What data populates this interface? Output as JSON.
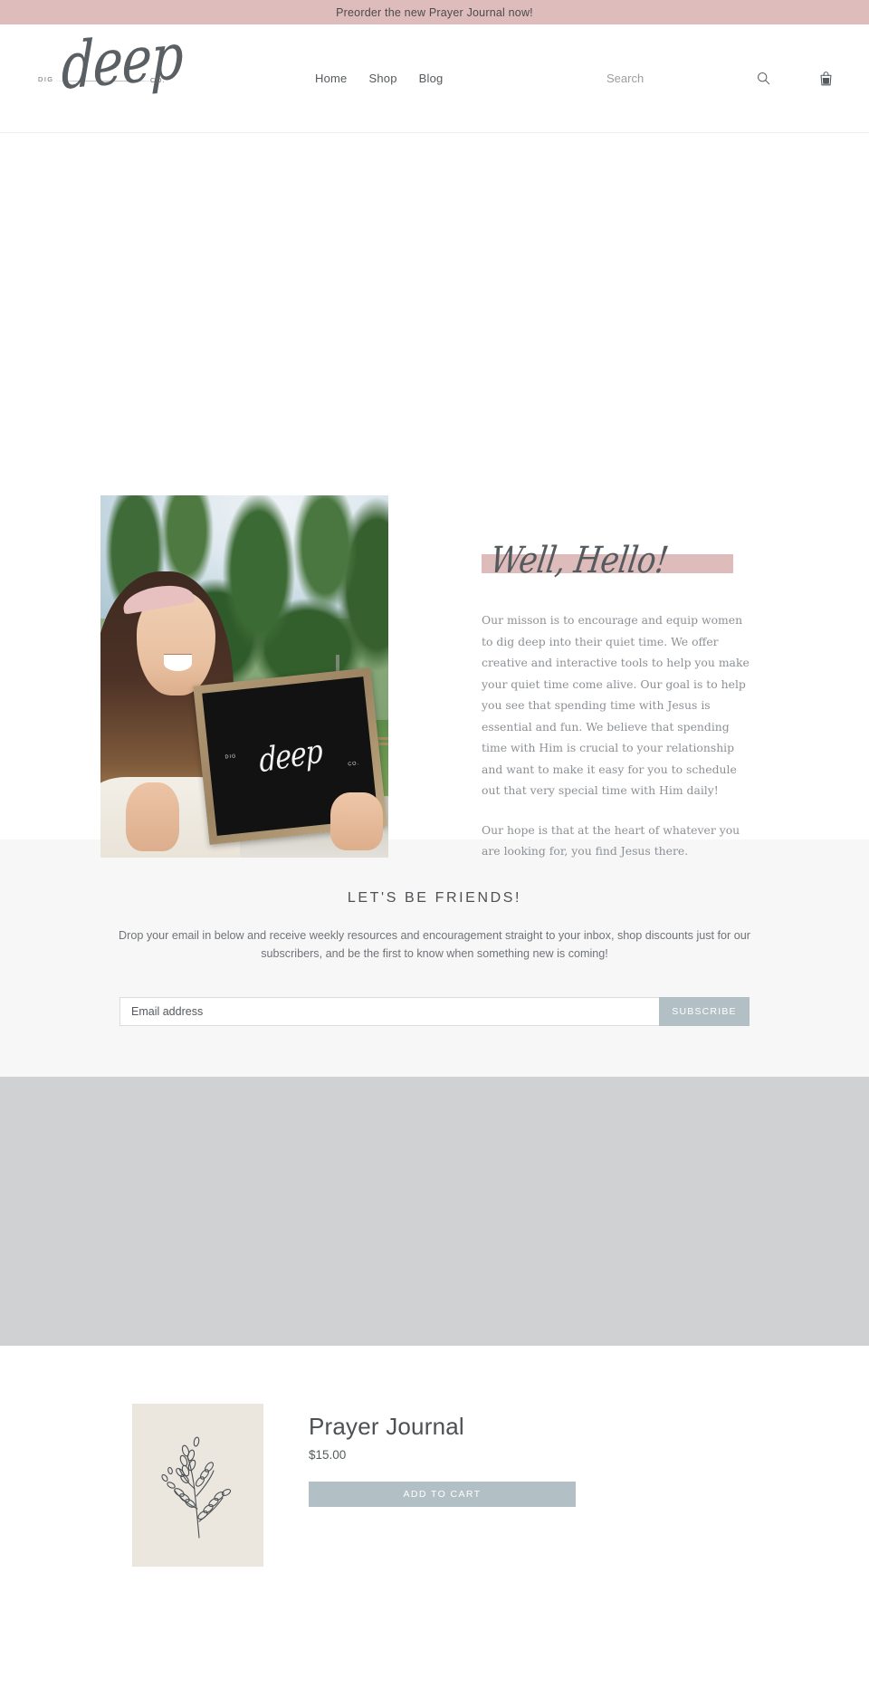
{
  "announcement": {
    "text": "Preorder the new Prayer Journal now!",
    "background": "#debcbc"
  },
  "header": {
    "logo": {
      "prefix": "DIG",
      "script": "deep",
      "suffix": "CO."
    },
    "nav": [
      {
        "label": "Home"
      },
      {
        "label": "Shop"
      },
      {
        "label": "Blog"
      }
    ],
    "search": {
      "placeholder": "Search"
    },
    "icons": {
      "search": "search-icon",
      "cart": "shopping-bag-icon"
    }
  },
  "about": {
    "heading": "Well, Hello!",
    "heading_highlight_color": "#debcbc",
    "photo_alt": "Woman holding a DIG deep CO. wooden framed chalkboard sign outdoors",
    "sign": {
      "prefix": "DIG",
      "script": "deep",
      "suffix": "CO."
    },
    "paragraphs": [
      "Our misson is to encourage and equip women to dig deep into their quiet time. We offer creative and interactive tools to help you make your quiet time come alive. Our goal is to help you see that spending time with Jesus is essential and fun. We believe that spending time with Him is crucial to your relationship and want to make it easy for you to schedule out that very special time with Him daily!",
      "Our hope is that at the heart of whatever you are looking for, you find Jesus there."
    ]
  },
  "newsletter": {
    "title": "LET'S BE FRIENDS!",
    "subtitle": "Drop your email in below and receive weekly resources and encouragement straight to your inbox, shop discounts just for our subscribers, and be the first to know when something new is coming!",
    "email_placeholder": "Email address",
    "email_value": "",
    "submit_label": "SUBSCRIBE",
    "submit_color": "#b2bfc5",
    "background": "#f7f7f7"
  },
  "media": {
    "background": "#cfd1d3"
  },
  "product": {
    "title": "Prayer Journal",
    "price": "$15.00",
    "add_to_cart_label": "ADD TO CART",
    "button_color": "#b2bfc5",
    "image_alt": "Botanical sprig illustration on cream background",
    "image_background": "#ece7de"
  }
}
